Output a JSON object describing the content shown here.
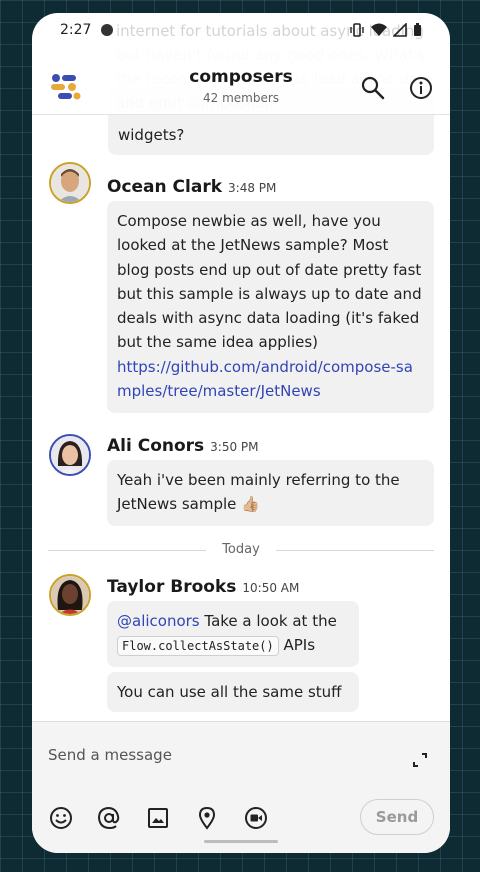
{
  "status_bar": {
    "time": "2:27"
  },
  "faded_overlay": "internet for tutorials about async loading but haven't found any good ones. What's the recommended way to load async data and emit composable",
  "channel": {
    "title": "composers",
    "subtitle": "42 members"
  },
  "messages": [
    {
      "type": "continuation",
      "text": "widgets?"
    },
    {
      "author": "Ocean Clark",
      "time": "3:48 PM",
      "text": "Compose newbie as well, have you looked at the JetNews sample? Most blog posts end up out of date pretty fast but this sample is always up to date and deals with async data loading (it's faked but the same idea applies)",
      "link": "https://github.com/android/compose-samples/tree/master/JetNews"
    },
    {
      "author": "Ali Conors",
      "time": "3:50 PM",
      "text": "Yeah i've been mainly referring to the JetNews sample 👍🏼"
    },
    {
      "author": "Taylor Brooks",
      "time": "10:50 AM",
      "mention": "@aliconors",
      "text_after_mention": " Take a look at the",
      "code": "Flow.collectAsState()",
      "text_after_code": " APIs",
      "followup": "You can use all the same stuff"
    }
  ],
  "day_divider": "Today",
  "composer": {
    "placeholder": "Send a message",
    "send_label": "Send",
    "tools": [
      "emoji-icon",
      "mention-icon",
      "image-icon",
      "location-icon",
      "video-icon"
    ]
  },
  "colors": {
    "accent": "#3145b6",
    "avatar_ring": "#c9a227",
    "background": "#0e2a33"
  }
}
